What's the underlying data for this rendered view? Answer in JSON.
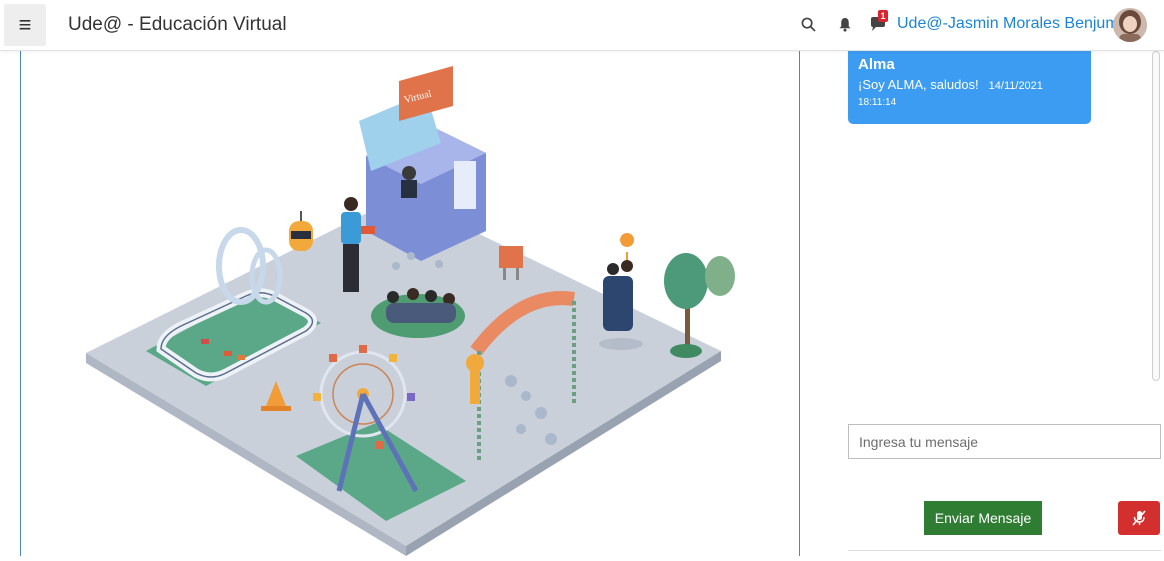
{
  "header": {
    "title": "Ude@ - Educación Virtual",
    "user_name": "Ude@-Jasmin Morales Benjumea",
    "notification_count": "1",
    "icons": [
      "menu-icon",
      "search-icon",
      "bell-icon",
      "chat-bubble-icon"
    ]
  },
  "illustration": {
    "kiosk_sign": "Virtual"
  },
  "chat": {
    "messages": [
      {
        "sender": "Alma",
        "text": "¡Soy ALMA, saludos!",
        "date": "14/11/2021",
        "time": "18:11:14"
      }
    ],
    "input_placeholder": "Ingresa tu mensaje",
    "send_label": "Enviar Mensaje"
  },
  "colors": {
    "accent": "#1b84d6",
    "bubble": "#3c9cf2",
    "send_button": "#2e7d32",
    "mic_button": "#d32f2f",
    "panel_border": "#4a86c8"
  }
}
